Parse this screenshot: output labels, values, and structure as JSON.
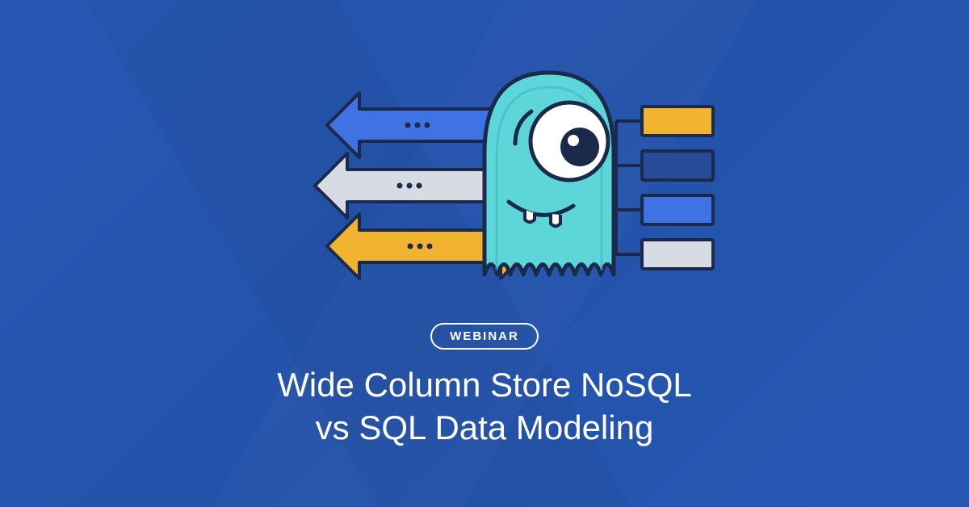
{
  "badge": {
    "label": "WEBINAR"
  },
  "title": {
    "line1": "Wide Column Store NoSQL",
    "line2": "vs SQL Data Modeling"
  },
  "colors": {
    "bg": "#2658b4",
    "blue": "#3f73e3",
    "darkblue": "#2a4a9a",
    "yellow": "#f2b430",
    "gray": "#d7dce4",
    "outline": "#1b2a4a",
    "mascot": "#5dd6da",
    "mascot_dark": "#3db8bd"
  }
}
